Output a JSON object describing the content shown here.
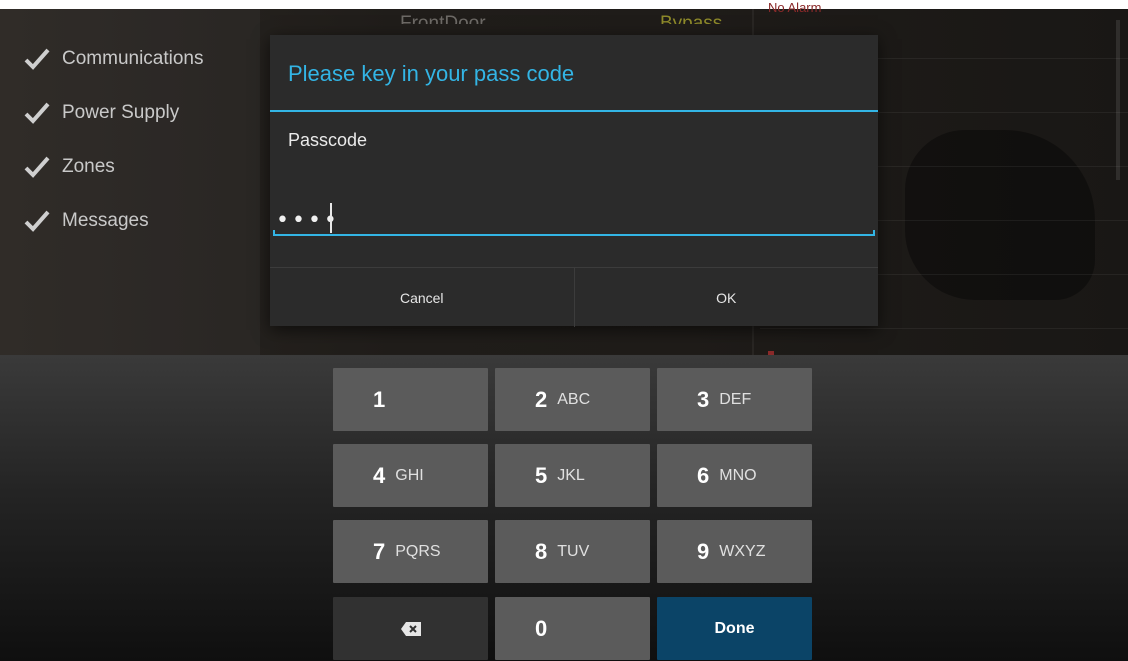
{
  "background": {
    "status_items": [
      {
        "label": "Communications",
        "icon": "check-icon"
      },
      {
        "label": "Power Supply",
        "icon": "check-icon"
      },
      {
        "label": "Zones",
        "icon": "check-icon"
      },
      {
        "label": "Messages",
        "icon": "check-icon"
      }
    ],
    "zone_name": "FrontDoor",
    "zone_state": "Bypass",
    "alarm_state": "No Alarm",
    "colors": {
      "zone_state": "#8e8a2a",
      "alarm_state": "#8b2a2a"
    }
  },
  "dialog": {
    "title": "Please key in your pass code",
    "field_label": "Passcode",
    "field_value": "••••",
    "cancel_label": "Cancel",
    "ok_label": "OK",
    "accent_color": "#33b5e5"
  },
  "keyboard": {
    "keys": [
      {
        "number": "1",
        "letters": ""
      },
      {
        "number": "2",
        "letters": "ABC"
      },
      {
        "number": "3",
        "letters": "DEF"
      },
      {
        "number": "4",
        "letters": "GHI"
      },
      {
        "number": "5",
        "letters": "JKL"
      },
      {
        "number": "6",
        "letters": "MNO"
      },
      {
        "number": "7",
        "letters": "PQRS"
      },
      {
        "number": "8",
        "letters": "TUV"
      },
      {
        "number": "9",
        "letters": "WXYZ"
      },
      {
        "number": "0",
        "letters": ""
      }
    ],
    "delete_icon": "backspace-icon",
    "done_label": "Done",
    "done_color": "#0b4467"
  }
}
